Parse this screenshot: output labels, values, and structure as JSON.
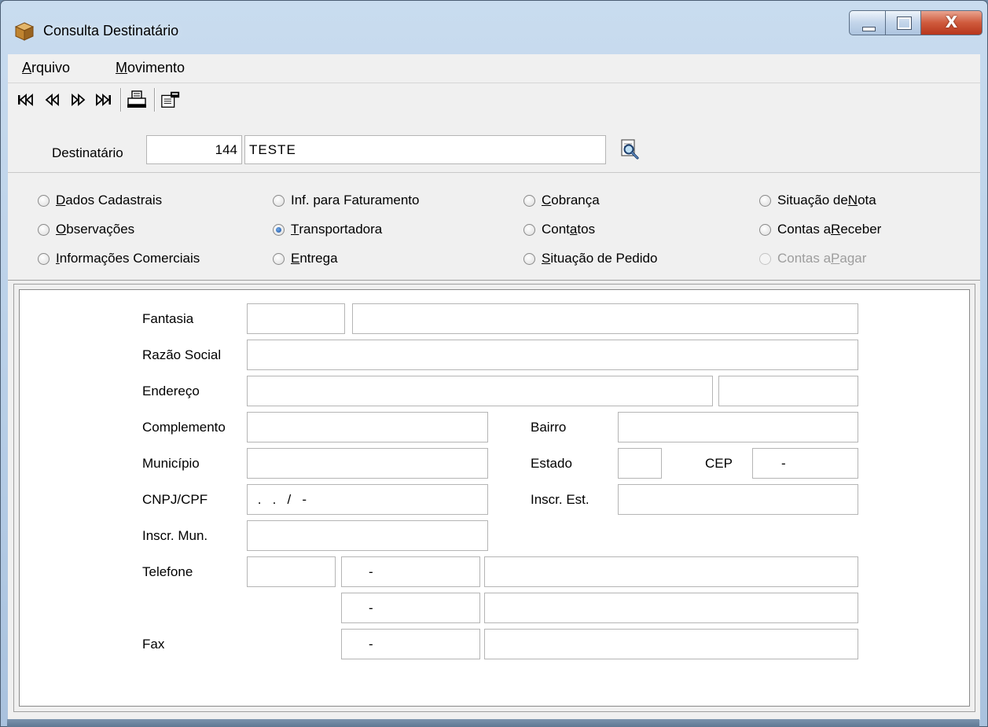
{
  "window": {
    "title": "Consulta Destinatário",
    "close_glyph": "X"
  },
  "menu": {
    "items": [
      {
        "key": "A",
        "rest": "rquivo"
      },
      {
        "key": "M",
        "rest": "ovimento"
      }
    ]
  },
  "toolbar": {
    "first": "KK",
    "prev": "◀◀",
    "next": "▶▶",
    "last": "▶|",
    "icons": [
      "first-record-icon",
      "previous-record-icon",
      "next-record-icon",
      "last-record-icon",
      "printer-icon",
      "properties-icon"
    ]
  },
  "destinatario": {
    "label": "Destinatário",
    "code": "144",
    "name": "TESTE"
  },
  "radios": {
    "dados_cadastrais": {
      "key": "D",
      "rest": "ados Cadastrais",
      "checked": false
    },
    "observacoes": {
      "key": "O",
      "rest": "bservações",
      "checked": false
    },
    "info_comerciais": {
      "key": "I",
      "rest": "nformações Comerciais",
      "checked": false
    },
    "inf_faturamento": {
      "label": "Inf. para Faturamento",
      "checked": false
    },
    "transportadora": {
      "key": "T",
      "rest": "ransportadora",
      "checked": true
    },
    "entrega": {
      "key": "E",
      "rest": "ntrega",
      "checked": false
    },
    "cobranca": {
      "key": "C",
      "rest": "obrança",
      "checked": false
    },
    "contatos": {
      "pre": "Cont",
      "key": "a",
      "rest": "tos",
      "checked": false
    },
    "situacao_pedido": {
      "key": "S",
      "rest": "ituação de Pedido",
      "checked": false
    },
    "situacao_nota": {
      "pre": "Situação de ",
      "key": "N",
      "rest": "ota",
      "checked": false
    },
    "contas_receber": {
      "pre": "Contas a ",
      "key": "R",
      "rest": "eceber",
      "checked": false
    },
    "contas_pagar": {
      "pre": "Contas a ",
      "key": "P",
      "rest": "agar",
      "checked": false,
      "disabled": true
    }
  },
  "form": {
    "labels": {
      "fantasia": "Fantasia",
      "razao_social": "Razão Social",
      "endereco": "Endereço",
      "complemento": "Complemento",
      "bairro": "Bairro",
      "municipio": "Município",
      "estado": "Estado",
      "cep": "CEP",
      "cnpj_cpf": "CNPJ/CPF",
      "inscr_est": "Inscr. Est.",
      "inscr_mun": "Inscr. Mun.",
      "telefone": "Telefone",
      "fax": "Fax"
    },
    "values": {
      "fantasia_code": "",
      "fantasia": "",
      "razao_social": "",
      "endereco": "",
      "endereco_numero": "",
      "complemento": "",
      "bairro": "",
      "municipio": "",
      "estado": "",
      "cep": "-",
      "cnpj_cpf": " .   .   /   -",
      "inscr_est": "",
      "inscr_mun": "",
      "telefone_ddd": "",
      "telefone1": "-",
      "telefone1_desc": "",
      "telefone2": "-",
      "telefone2_desc": "",
      "fax": "-",
      "fax_desc": ""
    }
  }
}
